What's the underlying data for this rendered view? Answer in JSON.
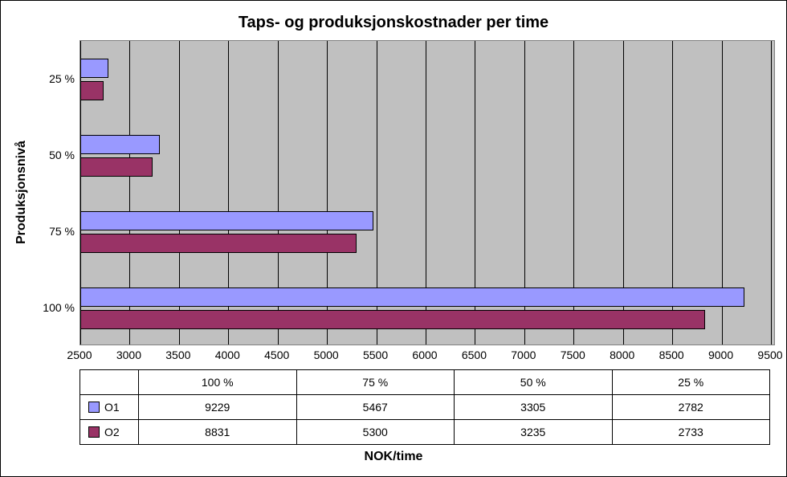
{
  "chart_data": {
    "type": "bar",
    "orientation": "horizontal",
    "title": "Taps- og produksjonskostnader per time",
    "xlabel": "NOK/time",
    "ylabel": "Produksjonsnivå",
    "categories": [
      "100 %",
      "75 %",
      "50 %",
      "25 %"
    ],
    "series": [
      {
        "name": "O1",
        "values": [
          9229,
          5467,
          3305,
          2782
        ],
        "color": "#9999ff"
      },
      {
        "name": "O2",
        "values": [
          8831,
          5300,
          3235,
          2733
        ],
        "color": "#993366"
      }
    ],
    "xlim": [
      2500,
      9500
    ],
    "xticks": [
      2500,
      3000,
      3500,
      4000,
      4500,
      5000,
      5500,
      6000,
      6500,
      7000,
      7500,
      8000,
      8500,
      9000,
      9500
    ]
  }
}
